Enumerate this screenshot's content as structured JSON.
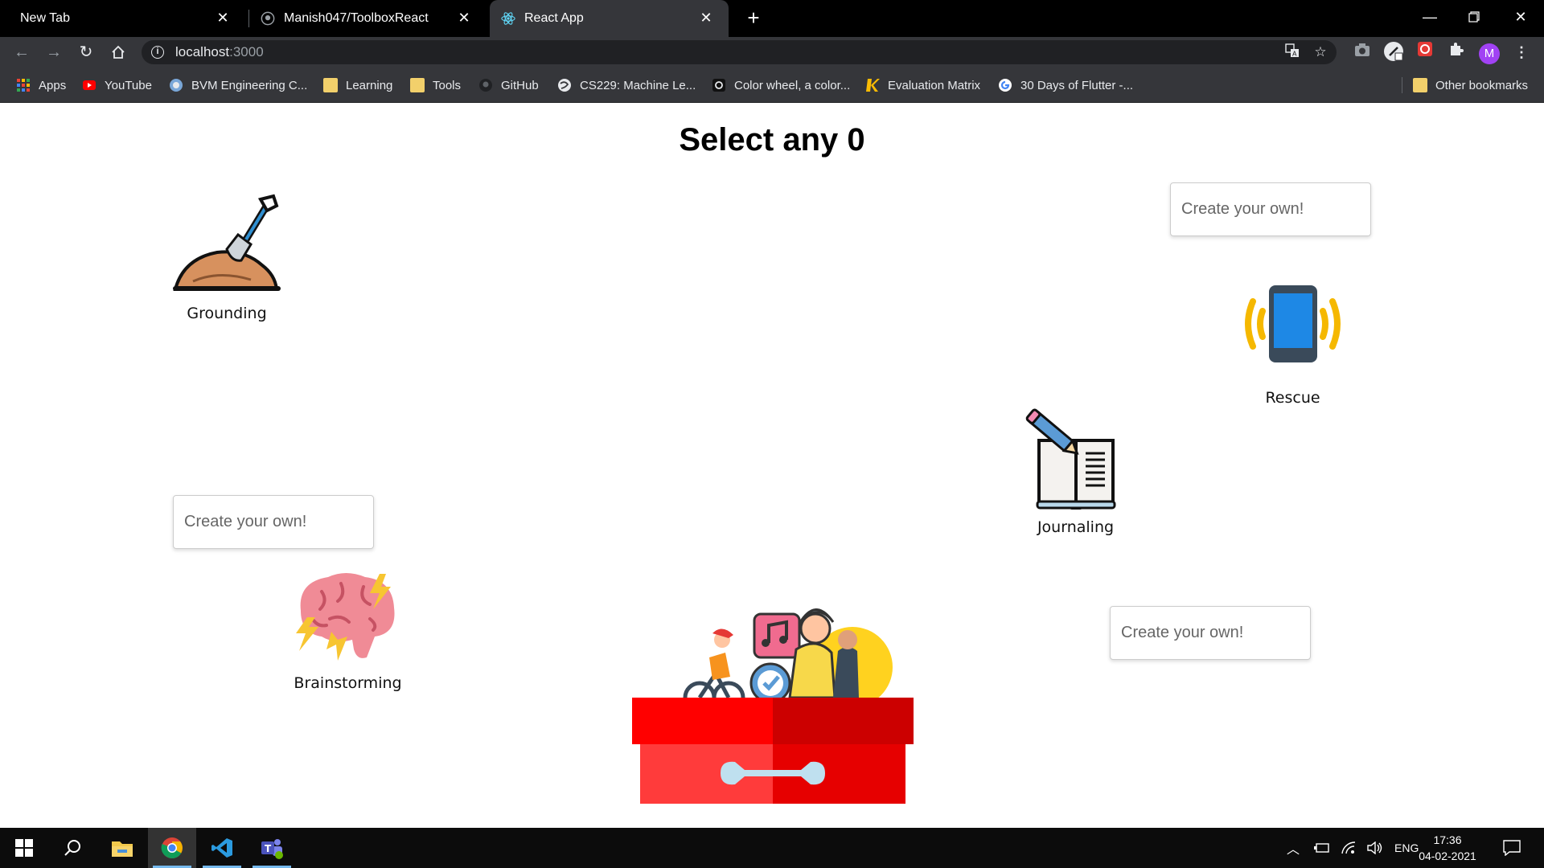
{
  "browser": {
    "tabs": [
      {
        "label": "New Tab"
      },
      {
        "label": "Manish047/ToolboxReact"
      },
      {
        "label": "React App"
      }
    ],
    "address": {
      "host": "localhost",
      "port": ":3000"
    },
    "profile_initial": "M"
  },
  "bookmarks": {
    "apps": "Apps",
    "items": [
      {
        "label": "YouTube",
        "icon": "youtube-icon"
      },
      {
        "label": "BVM Engineering C...",
        "icon": "bvm-icon"
      },
      {
        "label": "Learning",
        "icon": "folder-icon"
      },
      {
        "label": "Tools",
        "icon": "folder-icon"
      },
      {
        "label": "GitHub",
        "icon": "github-icon"
      },
      {
        "label": "CS229: Machine Le...",
        "icon": "globe-icon"
      },
      {
        "label": "Color wheel, a color...",
        "icon": "color-wheel-icon"
      },
      {
        "label": "Evaluation Matrix",
        "icon": "k-icon"
      },
      {
        "label": "30 Days of Flutter -...",
        "icon": "google-icon"
      }
    ],
    "other": "Other bookmarks"
  },
  "page": {
    "title": "Select any 0",
    "tools": {
      "grounding": "Grounding",
      "rescue": "Rescue",
      "journaling": "Journaling",
      "brainstorming": "Brainstorming"
    },
    "create_placeholder": "Create your own!"
  },
  "taskbar": {
    "language": "ENG",
    "time": "17:36",
    "date": "04-02-2021"
  },
  "colors": {
    "toolbox_red": "#ff0000",
    "toolbox_dark_red": "#cc0000",
    "rescue_blue": "#1e88e5",
    "rescue_waves": "#f5b800"
  }
}
